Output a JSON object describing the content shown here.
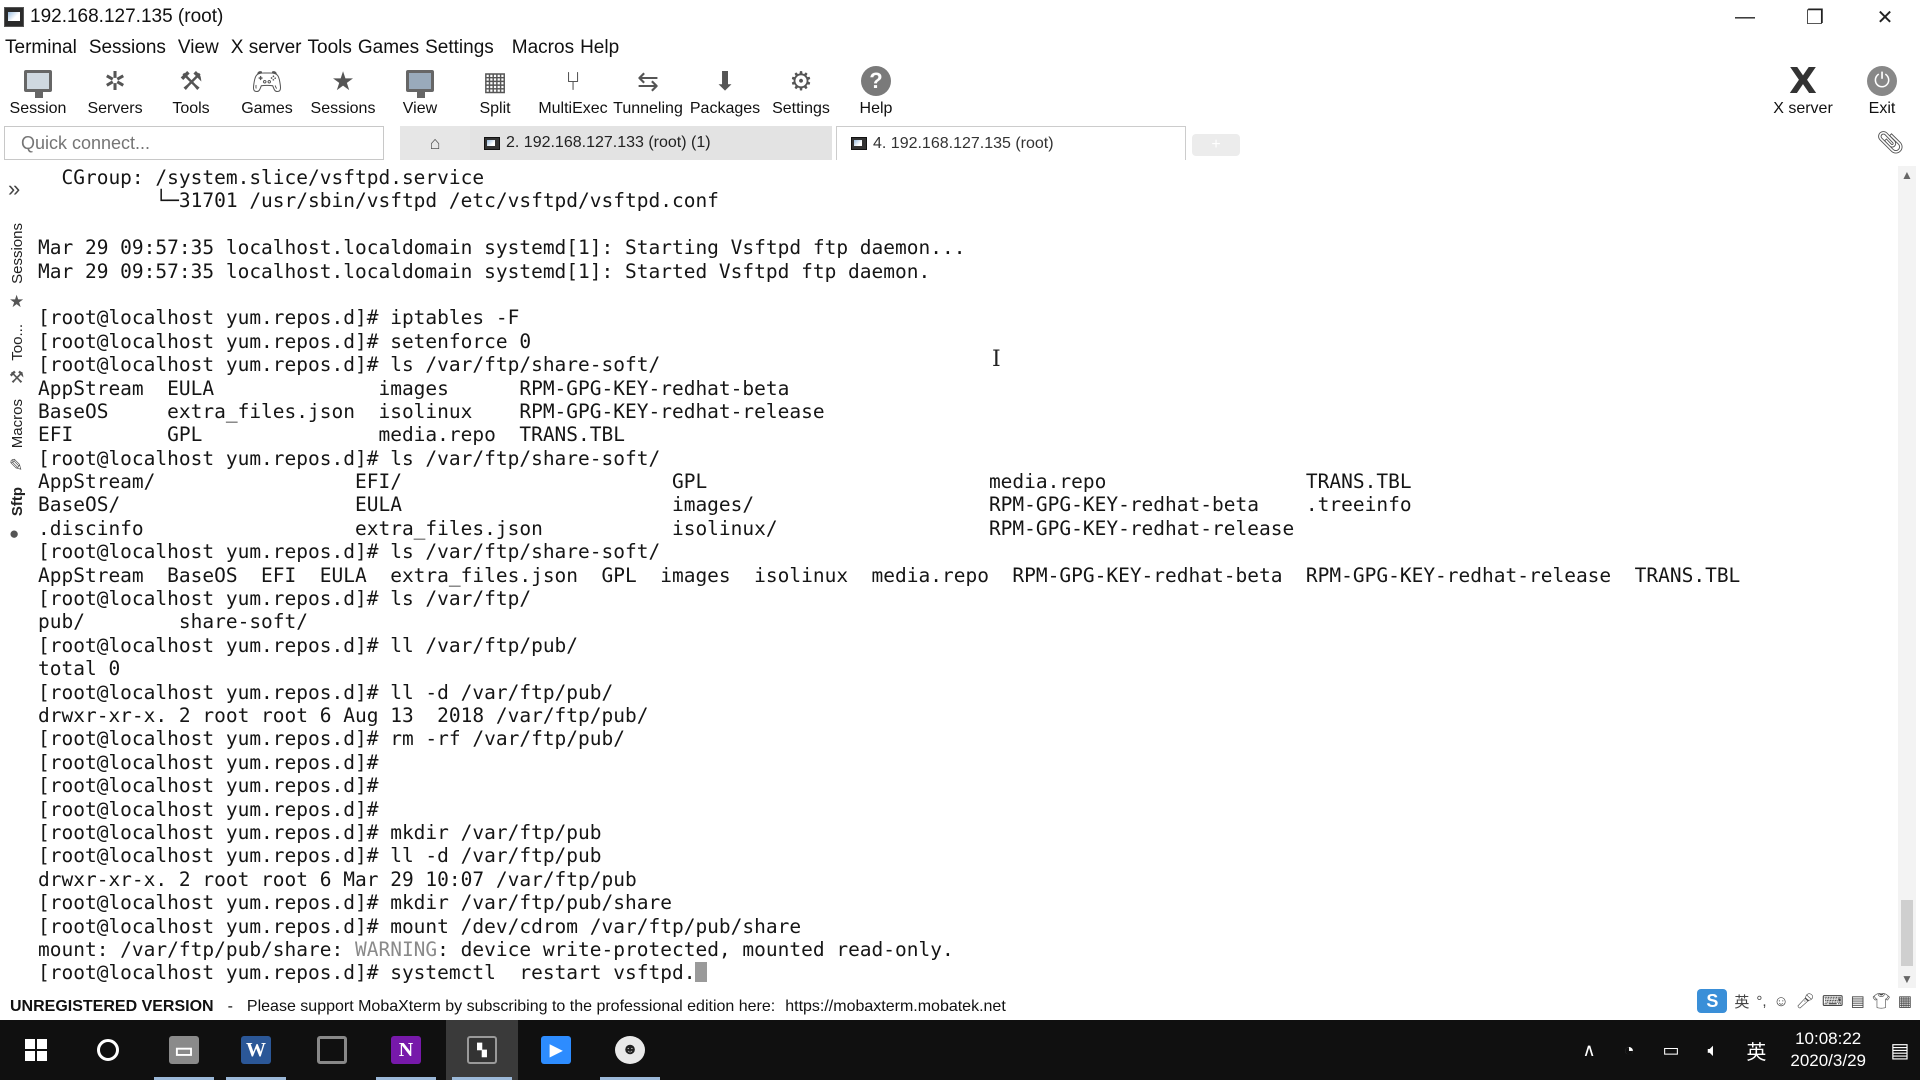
{
  "window": {
    "title": "192.168.127.135 (root)",
    "minimize": "—",
    "restore": "❐",
    "close": "✕"
  },
  "menu": [
    "Terminal",
    "Sessions",
    "View",
    "X server",
    "Tools",
    "Games",
    "Settings",
    "Macros",
    "Help"
  ],
  "toolbar": {
    "session": "Session",
    "servers": "Servers",
    "tools": "Tools",
    "games": "Games",
    "sessions": "Sessions",
    "view": "View",
    "split": "Split",
    "multiexec": "MultiExec",
    "tunneling": "Tunneling",
    "packages": "Packages",
    "settings": "Settings",
    "help": "Help",
    "xserver": "X server",
    "exit": "Exit"
  },
  "quick_connect": {
    "placeholder": "Quick connect..."
  },
  "tabs": [
    {
      "label": "2. 192.168.127.133 (root) (1)",
      "active": false
    },
    {
      "label": "4. 192.168.127.135 (root)",
      "active": true
    }
  ],
  "sidebar": {
    "sessions": "Sessions",
    "tools": "Too...",
    "macros": "Macros",
    "sftp": "Sftp"
  },
  "terminal": {
    "lines": [
      "  CGroup: /system.slice/vsftpd.service",
      "          └─31701 /usr/sbin/vsftpd /etc/vsftpd/vsftpd.conf",
      "",
      "Mar 29 09:57:35 localhost.localdomain systemd[1]: Starting Vsftpd ftp daemon...",
      "Mar 29 09:57:35 localhost.localdomain systemd[1]: Started Vsftpd ftp daemon.",
      "",
      "[root@localhost yum.repos.d]# iptables -F",
      "[root@localhost yum.repos.d]# setenforce 0",
      "[root@localhost yum.repos.d]# ls /var/ftp/share-soft/",
      "AppStream  EULA              images      RPM-GPG-KEY-redhat-beta",
      "BaseOS     extra_files.json  isolinux    RPM-GPG-KEY-redhat-release",
      "EFI        GPL               media.repo  TRANS.TBL",
      "[root@localhost yum.repos.d]# ls /var/ftp/share-soft/",
      "AppStream/                 EFI/                       GPL                        media.repo                 TRANS.TBL",
      "BaseOS/                    EULA                       images/                    RPM-GPG-KEY-redhat-beta    .treeinfo",
      ".discinfo                  extra_files.json           isolinux/                  RPM-GPG-KEY-redhat-release",
      "[root@localhost yum.repos.d]# ls /var/ftp/share-soft/",
      "AppStream  BaseOS  EFI  EULA  extra_files.json  GPL  images  isolinux  media.repo  RPM-GPG-KEY-redhat-beta  RPM-GPG-KEY-redhat-release  TRANS.TBL",
      "[root@localhost yum.repos.d]# ls /var/ftp/",
      "pub/        share-soft/",
      "[root@localhost yum.repos.d]# ll /var/ftp/pub/",
      "total 0",
      "[root@localhost yum.repos.d]# ll -d /var/ftp/pub/",
      "drwxr-xr-x. 2 root root 6 Aug 13  2018 /var/ftp/pub/",
      "[root@localhost yum.repos.d]# rm -rf /var/ftp/pub/",
      "[root@localhost yum.repos.d]#",
      "[root@localhost yum.repos.d]#",
      "[root@localhost yum.repos.d]#",
      "[root@localhost yum.repos.d]# mkdir /var/ftp/pub",
      "[root@localhost yum.repos.d]# ll -d /var/ftp/pub",
      "drwxr-xr-x. 2 root root 6 Mar 29 10:07 /var/ftp/pub",
      "[root@localhost yum.repos.d]# mkdir /var/ftp/pub/share",
      "[root@localhost yum.repos.d]# mount /dev/cdrom /var/ftp/pub/share"
    ],
    "warning_line": {
      "prefix": "mount: /var/ftp/pub/share: ",
      "warning": "WARNING",
      "suffix": ": device write-protected, mounted read-only."
    },
    "current_prompt": "[root@localhost yum.repos.d]# ",
    "current_input": "systemctl  restart vsftpd."
  },
  "status": {
    "unregistered": "UNREGISTERED VERSION",
    "dash": "-",
    "message": "Please support MobaXterm by subscribing to the professional edition here:",
    "link": "https://mobaxterm.mobatek.net"
  },
  "ime": {
    "logo": "S",
    "lang": "英"
  },
  "taskbar": {
    "time": "10:08:22",
    "date": "2020/3/29",
    "lang": "英"
  },
  "colors": {
    "word": "#2b5797",
    "onenote": "#7719aa",
    "zoom": "#2d8cff",
    "taskbar_bg": "#101010"
  }
}
